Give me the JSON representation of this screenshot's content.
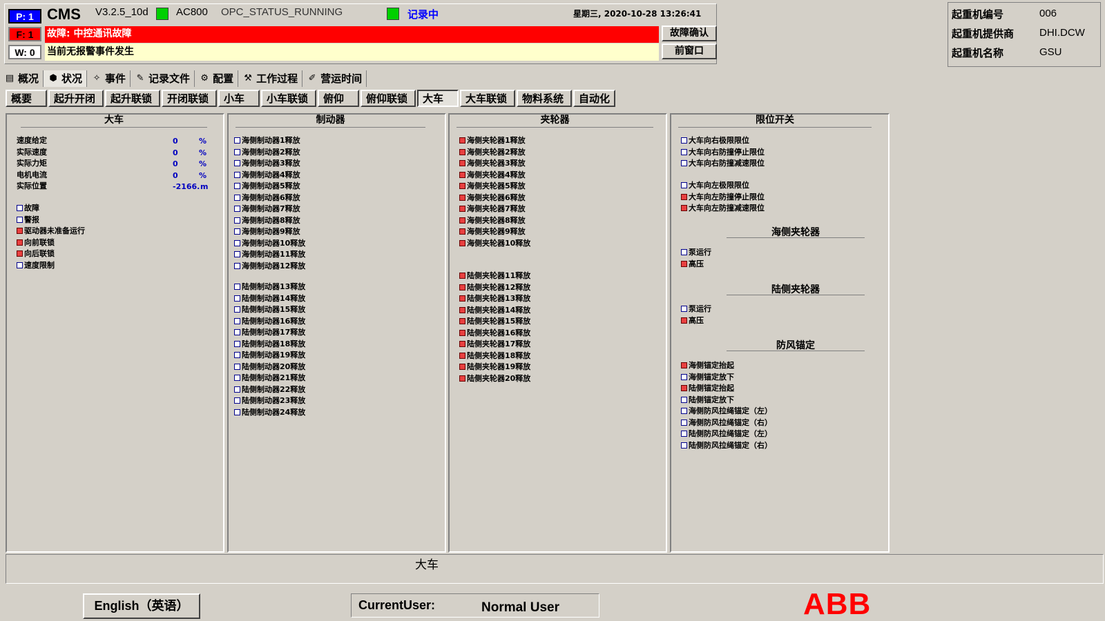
{
  "header": {
    "badge_p": "P: 1",
    "badge_f": "F: 1",
    "badge_w": "W: 0",
    "app_name": "CMS",
    "version": "V3.2.5_10d",
    "system": "AC800",
    "opc_status": "OPC_STATUS_RUNNING",
    "recording": "记录中",
    "datetime": "星期三, 2020-10-28  13:26:41",
    "fault_text": "故障: 中控通讯故障",
    "warning_text": "当前无报警事件发生",
    "ack_button": "故障确认",
    "prev_window_button": "前窗口"
  },
  "crane_info": {
    "rows": [
      {
        "label": "起重机编号",
        "value": "006"
      },
      {
        "label": "起重机提供商",
        "value": "DHI.DCW"
      },
      {
        "label": "起重机名称",
        "value": "GSU"
      }
    ]
  },
  "tabs": [
    {
      "label": "概况",
      "icon": "overview-icon"
    },
    {
      "label": "状况",
      "icon": "status-icon"
    },
    {
      "label": "事件",
      "icon": "event-icon"
    },
    {
      "label": "记录文件",
      "icon": "record-file-icon"
    },
    {
      "label": "配置",
      "icon": "config-icon"
    },
    {
      "label": "工作过程",
      "icon": "work-process-icon"
    },
    {
      "label": "营运时间",
      "icon": "operating-time-icon"
    }
  ],
  "subtabs": [
    "概要",
    "起升开闭",
    "起升联锁",
    "开闭联锁",
    "小车",
    "小车联锁",
    "俯仰",
    "俯仰联锁",
    "大车",
    "大车联锁",
    "物料系统",
    "自动化"
  ],
  "panels": {
    "gantry": {
      "title": "大车",
      "values": [
        {
          "label": "速度给定",
          "value": "0",
          "unit": "%"
        },
        {
          "label": "实际速度",
          "value": "0",
          "unit": "%"
        },
        {
          "label": "实际力矩",
          "value": "0",
          "unit": "%"
        },
        {
          "label": "电机电流",
          "value": "0",
          "unit": "%"
        },
        {
          "label": "实际位置",
          "value": "-2166.",
          "unit": "m"
        }
      ],
      "flags": [
        {
          "label": "故障",
          "on": false
        },
        {
          "label": "警报",
          "on": false
        },
        {
          "label": "驱动器未准备运行",
          "on": true
        },
        {
          "label": "向前联锁",
          "on": true
        },
        {
          "label": "向后联锁",
          "on": true
        },
        {
          "label": "速度限制",
          "on": false
        }
      ]
    },
    "brakes": {
      "title": "制动器",
      "sea": [
        "海侧制动器1释放",
        "海侧制动器2释放",
        "海侧制动器3释放",
        "海侧制动器4释放",
        "海侧制动器5释放",
        "海侧制动器6释放",
        "海侧制动器7释放",
        "海侧制动器8释放",
        "海侧制动器9释放",
        "海侧制动器10释放",
        "海侧制动器11释放",
        "海侧制动器12释放"
      ],
      "land": [
        "陆侧制动器13释放",
        "陆侧制动器14释放",
        "陆侧制动器15释放",
        "陆侧制动器16释放",
        "陆侧制动器17释放",
        "陆侧制动器18释放",
        "陆侧制动器19释放",
        "陆侧制动器20释放",
        "陆侧制动器21释放",
        "陆侧制动器22释放",
        "陆侧制动器23释放",
        "陆侧制动器24释放"
      ]
    },
    "clamps": {
      "title": "夹轮器",
      "sea": [
        "海侧夹轮器1释放",
        "海侧夹轮器2释放",
        "海侧夹轮器3释放",
        "海侧夹轮器4释放",
        "海侧夹轮器5释放",
        "海侧夹轮器6释放",
        "海侧夹轮器7释放",
        "海侧夹轮器8释放",
        "海侧夹轮器9释放",
        "海侧夹轮器10释放"
      ],
      "land": [
        "陆侧夹轮器11释放",
        "陆侧夹轮器12释放",
        "陆侧夹轮器13释放",
        "陆侧夹轮器14释放",
        "陆侧夹轮器15释放",
        "陆侧夹轮器16释放",
        "陆侧夹轮器17释放",
        "陆侧夹轮器18释放",
        "陆侧夹轮器19释放",
        "陆侧夹轮器20释放"
      ]
    },
    "limits": {
      "title": "限位开关",
      "right": [
        {
          "label": "大车向右极限限位",
          "on": false
        },
        {
          "label": "大车向右防撞停止限位",
          "on": false
        },
        {
          "label": "大车向右防撞减速限位",
          "on": false
        }
      ],
      "left": [
        {
          "label": "大车向左极限限位",
          "on": false
        },
        {
          "label": "大车向左防撞停止限位",
          "on": true
        },
        {
          "label": "大车向左防撞减速限位",
          "on": true
        }
      ],
      "sea_clamp_title": "海侧夹轮器",
      "sea_clamp": [
        {
          "label": "泵运行",
          "on": false
        },
        {
          "label": "高压",
          "on": true
        }
      ],
      "land_clamp_title": "陆侧夹轮器",
      "land_clamp": [
        {
          "label": "泵运行",
          "on": false
        },
        {
          "label": "高压",
          "on": true
        }
      ],
      "anchor_title": "防风锚定",
      "anchor": [
        {
          "label": "海侧锚定抬起",
          "on": true
        },
        {
          "label": "海侧锚定放下",
          "on": false
        },
        {
          "label": "陆侧锚定抬起",
          "on": true
        },
        {
          "label": "陆侧锚定放下",
          "on": false
        },
        {
          "label": "海侧防风拉绳锚定（左）",
          "on": false
        },
        {
          "label": "海侧防风拉绳锚定（右）",
          "on": false
        },
        {
          "label": "陆侧防风拉绳锚定（左）",
          "on": false
        },
        {
          "label": "陆侧防风拉绳锚定（右）",
          "on": false
        }
      ]
    }
  },
  "statusbar": {
    "text": "大车"
  },
  "footer": {
    "language_button": "English（英语）",
    "current_user_label": "CurrentUser:",
    "current_user": "Normal User",
    "logo": "ABB"
  },
  "colors": {
    "on": "#e84040",
    "off": "#ffffff",
    "fault": "#ff0000",
    "warn": "#ffffcc",
    "logo": "#ff0000"
  }
}
